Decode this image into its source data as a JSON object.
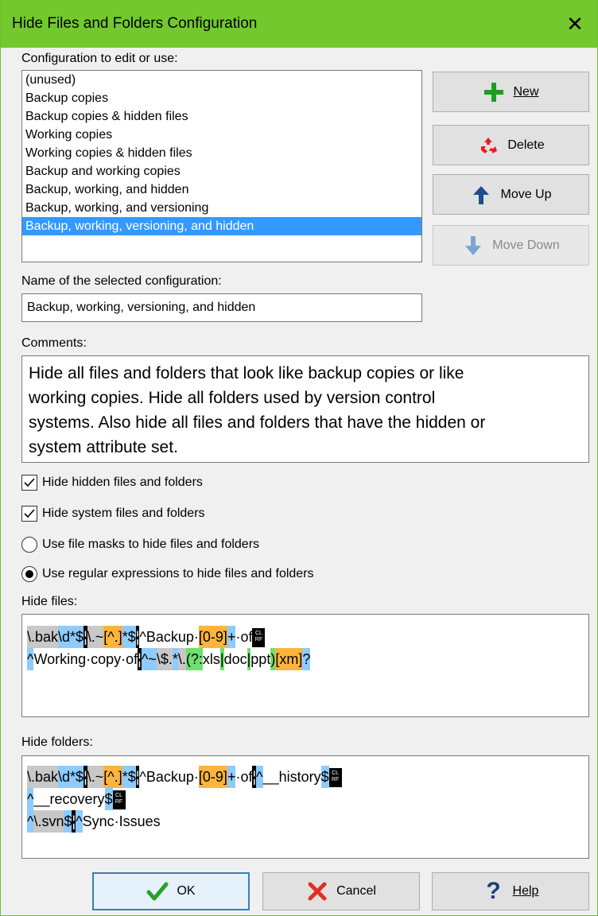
{
  "window": {
    "title": "Hide Files and Folders Configuration",
    "close_glyph": "✕"
  },
  "config_list": {
    "label": "Configuration to edit or use:",
    "items": [
      "(unused)",
      "Backup copies",
      "Backup copies & hidden files",
      "Working copies",
      "Working copies & hidden files",
      "Backup and working copies",
      "Backup, working, and hidden",
      "Backup, working, and versioning",
      "Backup, working, versioning, and hidden"
    ],
    "selected_index": 8
  },
  "buttons": {
    "new": {
      "label": "New",
      "icon": "plus-icon",
      "color": "#1e9e1e"
    },
    "delete": {
      "label": "Delete",
      "icon": "recycle-icon",
      "color": "#e02020"
    },
    "move_up": {
      "label": "Move Up",
      "icon": "arrow-up-icon",
      "color": "#1c4f8c"
    },
    "move_down": {
      "label": "Move Down",
      "icon": "arrow-down-icon",
      "color": "#7aa5d6",
      "disabled": true
    },
    "ok": {
      "label": "OK",
      "icon": "check-icon",
      "color": "#2aa02a"
    },
    "cancel": {
      "label": "Cancel",
      "icon": "x-icon",
      "color": "#e03020"
    },
    "help": {
      "label": "Help",
      "icon": "question-icon",
      "color": "#1c3f7c"
    }
  },
  "name_field": {
    "label": "Name of the selected configuration:",
    "value": "Backup, working, versioning, and hidden"
  },
  "comments": {
    "label": "Comments:",
    "lines": [
      "Hide all files and folders that look like backup copies or like",
      "working copies.  Hide all folders used by version control",
      "systems.  Also hide all files and folders that have the hidden or",
      "system attribute set."
    ]
  },
  "options": {
    "hide_hidden": {
      "label": "Hide hidden files and folders",
      "checked": true
    },
    "hide_system": {
      "label": "Hide system files and folders",
      "checked": true
    },
    "use_file_masks": {
      "label": "Use file masks to hide files and folders",
      "selected": false
    },
    "use_regex": {
      "label": "Use regular expressions to hide files and folders",
      "selected": true
    }
  },
  "hide_files": {
    "label": "Hide files:",
    "line1": [
      "\\.bak",
      "\\d*$",
      "\\.~",
      "[^.]",
      "*$",
      "^Backup·",
      "[0-9]",
      "+",
      "·of"
    ],
    "line2": [
      "^",
      "Working·copy·of",
      "^~",
      "\\$.",
      "*",
      "\\.",
      "(?:",
      "xls",
      "|",
      "doc",
      "|",
      "ppt",
      ")",
      "[xm]",
      "?"
    ]
  },
  "hide_folders": {
    "label": "Hide folders:",
    "line1": [
      "\\.bak",
      "\\d*$",
      "\\.~",
      "[^.]",
      "*$",
      "^Backup·",
      "[0-9]",
      "+",
      "·of",
      "^",
      "__history",
      "$"
    ],
    "line2": [
      "^",
      "__recovery",
      "$"
    ],
    "line3": [
      "^",
      "\\.svn",
      "$",
      "^",
      "Sync·Issues"
    ]
  },
  "newline_marker": {
    "top": "CL",
    "bottom": "RF"
  },
  "colors": {
    "titlebar": "#72c82c",
    "selection": "#3399ff",
    "regex_literal": "#c8c8c8",
    "regex_anchor": "#8ecbff",
    "regex_class": "#ffb43c",
    "regex_group": "#6fe06f"
  }
}
